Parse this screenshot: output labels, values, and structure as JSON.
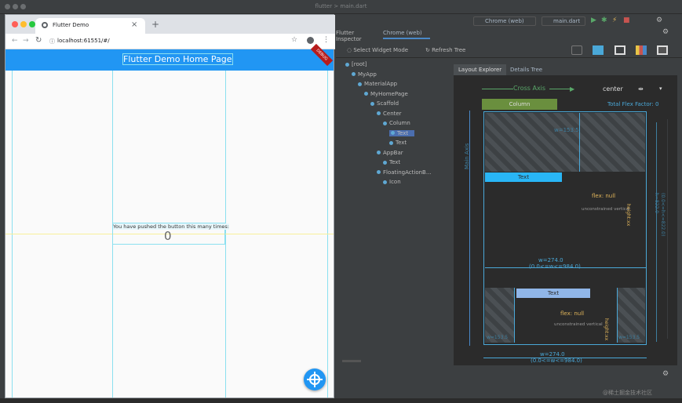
{
  "ide": {
    "title": "flutter > main.dart"
  },
  "browser": {
    "tab_title": "Flutter Demo",
    "url": "localhost:61551/#/",
    "app_title": "Flutter Demo Home Page",
    "debug_banner": "DEBUG",
    "message": "You have pushed the button this many times:",
    "counter": "0"
  },
  "inspector": {
    "tabs": [
      "Flutter Inspector",
      "Chrome (web)"
    ],
    "device": "Chrome (web)",
    "file": "main.dart",
    "select_widget_mode": "Select Widget Mode",
    "refresh_tree": "Refresh Tree",
    "right_tabs": [
      "Layout Explorer",
      "Details Tree"
    ],
    "tree": [
      {
        "label": "[root]",
        "depth": 0
      },
      {
        "label": "MyApp",
        "depth": 1
      },
      {
        "label": "MaterialApp",
        "depth": 2
      },
      {
        "label": "MyHomePage",
        "depth": 3
      },
      {
        "label": "Scaffold",
        "depth": 4
      },
      {
        "label": "Center",
        "depth": 5
      },
      {
        "label": "Column",
        "depth": 6
      },
      {
        "label": "Text",
        "depth": 7,
        "selected": true
      },
      {
        "label": "Text",
        "depth": 7
      },
      {
        "label": "AppBar",
        "depth": 5
      },
      {
        "label": "Text",
        "depth": 6
      },
      {
        "label": "FloatingActionB...",
        "depth": 5
      },
      {
        "label": "Icon",
        "depth": 6
      }
    ],
    "layout": {
      "cross_axis": "Cross Axis",
      "cross_value": "center",
      "column_label": "Column",
      "total_flex": "Total Flex Factor: 0",
      "main_axis": "Main Axis",
      "top_size": "w=153.5",
      "text1": "Text",
      "flex_null_1": "flex: null",
      "unconstrained_1": "unconstrained vertical",
      "height_1": "height:xx",
      "w_mid": "w=274.0",
      "w_mid_sub": "(0.0<=w<=984.0)",
      "text2": "Text",
      "flex_null_2": "flex: null",
      "unconstrained_2": "unconstrained vertical",
      "height_2": "height:xx",
      "w_left": "w=153.5",
      "w_right": "w=153.5",
      "w_bottom": "w=274.0",
      "w_bottom_sub": "(0.0<=w<=984.0)",
      "h_right": "h=822.0",
      "h_right_sub": "(0.0<=h<=822.0)"
    }
  },
  "colors": {
    "flutter_blue": "#2196f3",
    "ide_bg": "#3c3f41",
    "accent_blue": "#4aa8d8",
    "flex_green": "#6a8f3e"
  },
  "watermark": "@稀土掘金技术社区"
}
